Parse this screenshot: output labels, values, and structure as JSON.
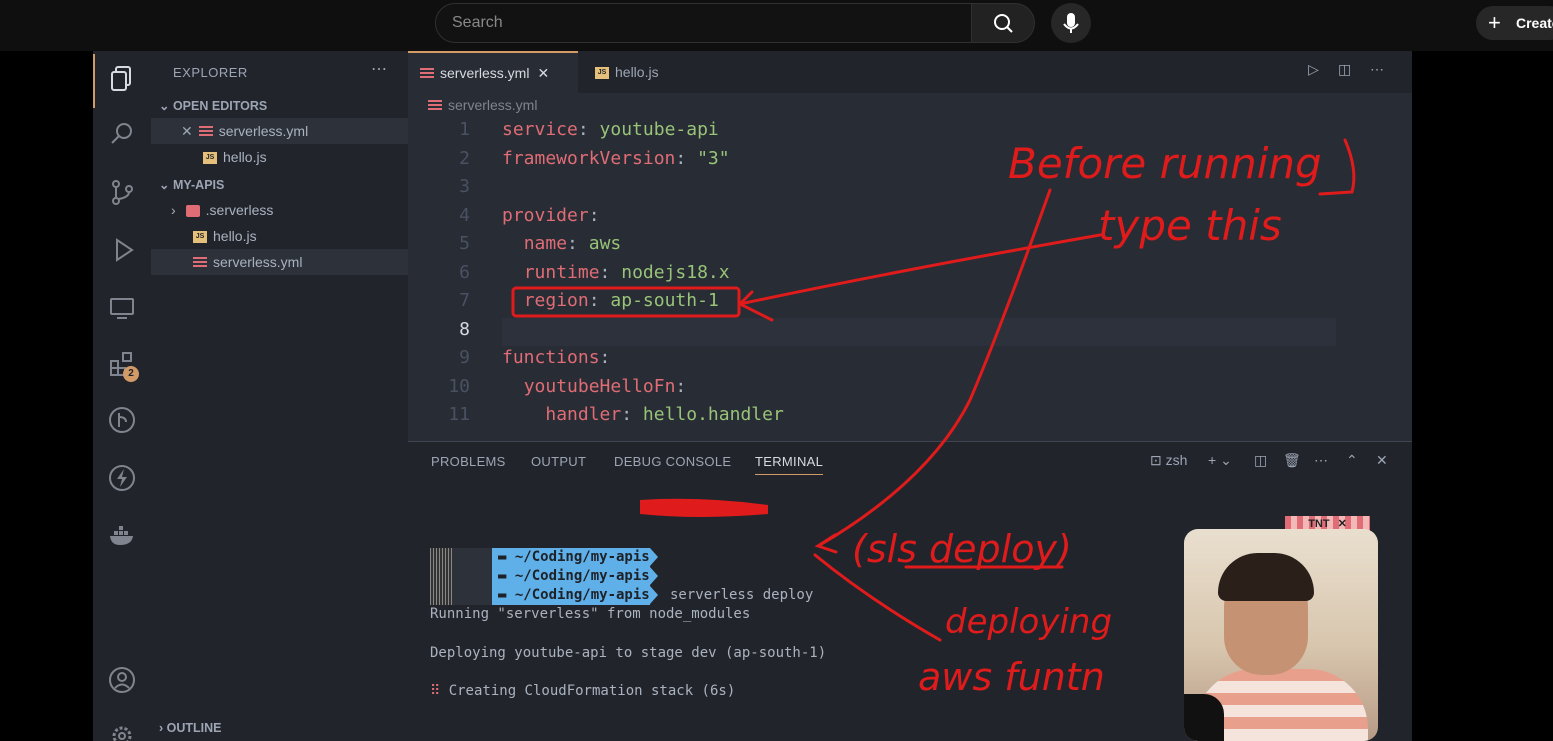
{
  "youtube": {
    "search_placeholder": "Search",
    "create_label": "Create"
  },
  "explorer": {
    "title": "EXPLORER",
    "open_editors_label": "OPEN EDITORS",
    "open_editors": [
      "serverless.yml",
      "hello.js"
    ],
    "project_label": "MY-APIS",
    "files": [
      ".serverless",
      "hello.js",
      "serverless.yml"
    ],
    "outline_label": "OUTLINE"
  },
  "extensions_badge": "2",
  "editor": {
    "tabs": [
      "serverless.yml",
      "hello.js"
    ],
    "breadcrumb": "serverless.yml",
    "lines": [
      {
        "n": "1",
        "key": "service",
        "val": "youtube-api",
        "indent": ""
      },
      {
        "n": "2",
        "key": "frameworkVersion",
        "val": "\"3\"",
        "indent": ""
      },
      {
        "n": "3",
        "key": "",
        "val": "",
        "indent": ""
      },
      {
        "n": "4",
        "key": "provider",
        "val": "",
        "indent": ""
      },
      {
        "n": "5",
        "key": "name",
        "val": "aws",
        "indent": "  "
      },
      {
        "n": "6",
        "key": "runtime",
        "val": "nodejs18.x",
        "indent": "  "
      },
      {
        "n": "7",
        "key": "region",
        "val": "ap-south-1",
        "indent": "  "
      },
      {
        "n": "8",
        "key": "",
        "val": "",
        "indent": ""
      },
      {
        "n": "9",
        "key": "functions",
        "val": "",
        "indent": ""
      },
      {
        "n": "10",
        "key": "youtubeHelloFn",
        "val": "",
        "indent": "  "
      },
      {
        "n": "11",
        "key": "handler",
        "val": "hello.handler",
        "indent": "    "
      }
    ]
  },
  "panel": {
    "tabs": [
      "PROBLEMS",
      "OUTPUT",
      "DEBUG CONSOLE",
      "TERMINAL"
    ],
    "shell": "zsh",
    "prompt_path_prefix": "~/Coding/",
    "prompt_path_dir": "my-apis",
    "command": "serverless deploy",
    "output": [
      "Running \"serverless\" from node_modules",
      "Deploying youtube-api to stage dev (ap-south-1)",
      "Creating CloudFormation stack (6s)"
    ]
  },
  "overlay": {
    "tnt_label": "TNT"
  },
  "annotations": {
    "note1": "Before running",
    "note2": "type this",
    "note3": "(sls deploy)",
    "note4": "deploying",
    "note5": "aws funtn"
  }
}
